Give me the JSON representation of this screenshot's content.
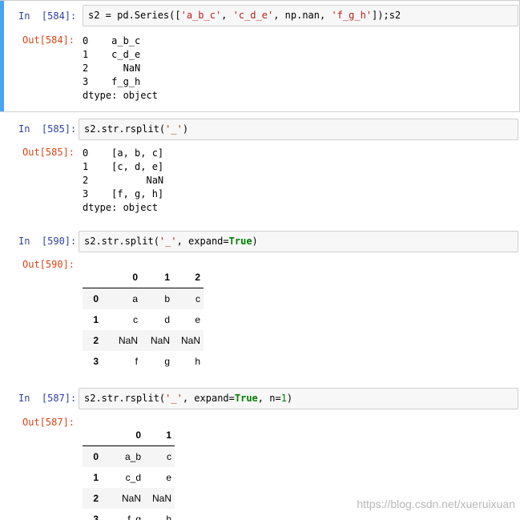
{
  "cells": [
    {
      "in_prompt": "In  [584]:",
      "out_prompt": "Out[584]:",
      "code_parts": {
        "p0": "s2 = pd.Series([",
        "s0": "'a_b_c'",
        "p1": ", ",
        "s1": "'c_d_e'",
        "p2": ", np.nan, ",
        "s2": "'f_g_h'",
        "p3": "]);s2"
      },
      "output": "0    a_b_c\n1    c_d_e\n2      NaN\n3    f_g_h\ndtype: object"
    },
    {
      "in_prompt": "In  [585]:",
      "out_prompt": "Out[585]:",
      "code_parts": {
        "p0": "s2.str.rsplit(",
        "s0": "'_'",
        "p1": ")"
      },
      "output": "0    [a, b, c]\n1    [c, d, e]\n2          NaN\n3    [f, g, h]\ndtype: object"
    },
    {
      "in_prompt": "In  [590]:",
      "out_prompt": "Out[590]:",
      "code_parts": {
        "p0": "s2.str.split(",
        "s0": "'_'",
        "p1": ", expand=",
        "k0": "True",
        "p2": ")"
      },
      "table": {
        "header": [
          "",
          "0",
          "1",
          "2"
        ],
        "rows": [
          [
            "0",
            "a",
            "b",
            "c"
          ],
          [
            "1",
            "c",
            "d",
            "e"
          ],
          [
            "2",
            "NaN",
            "NaN",
            "NaN"
          ],
          [
            "3",
            "f",
            "g",
            "h"
          ]
        ]
      }
    },
    {
      "in_prompt": "In  [587]:",
      "out_prompt": "Out[587]:",
      "code_parts": {
        "p0": "s2.str.rsplit(",
        "s0": "'_'",
        "p1": ", expand=",
        "k0": "True",
        "p2": ", n=",
        "n0": "1",
        "p3": ")"
      },
      "table": {
        "header": [
          "",
          "0",
          "1"
        ],
        "rows": [
          [
            "0",
            "a_b",
            "c"
          ],
          [
            "1",
            "c_d",
            "e"
          ],
          [
            "2",
            "NaN",
            "NaN"
          ],
          [
            "3",
            "f_g",
            "h"
          ]
        ]
      }
    }
  ],
  "watermark": "https://blog.csdn.net/xueruixuan"
}
